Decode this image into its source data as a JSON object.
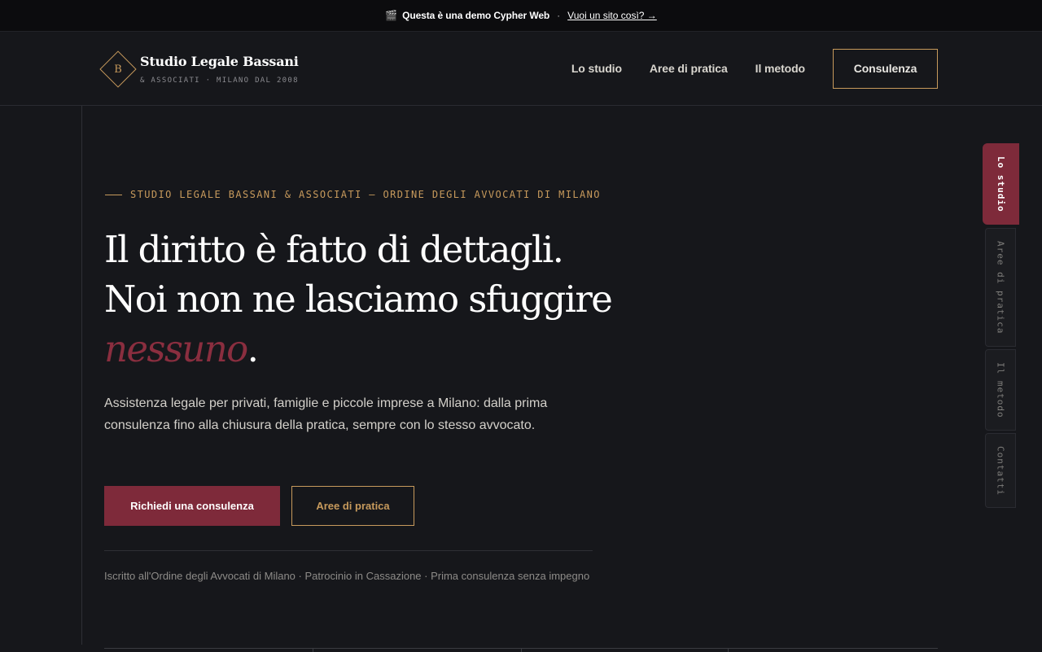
{
  "demo_bar": {
    "icon": "clapperboard-icon",
    "text": "Questa è una demo Cypher Web",
    "separator": "·",
    "link": "Vuoi un sito così? →"
  },
  "brand": {
    "monogram": "B",
    "name": "Studio Legale Bassani",
    "subtitle": "& ASSOCIATI · MILANO DAL 2008"
  },
  "nav": {
    "items": [
      "Lo studio",
      "Aree di pratica",
      "Il metodo"
    ],
    "cta": "Consulenza"
  },
  "hero": {
    "eyebrow": "STUDIO LEGALE BASSANI & ASSOCIATI — ORDINE DEGLI AVVOCATI DI MILANO",
    "headline_line1": "Il diritto è fatto di dettagli.",
    "headline_line2": "Noi non ne lasciamo sfuggire",
    "headline_accent": "nessuno",
    "headline_end": ".",
    "lead": "Assistenza legale per privati, famiglie e piccole imprese a Milano: dalla prima consulenza fino alla chiusura della pratica, sempre con lo stesso avvocato.",
    "primary_button": "Richiedi una consulenza",
    "secondary_button": "Aree di pratica",
    "credentials": "Iscritto all'Ordine degli Avvocati di Milano · Patrocinio in Cassazione · Prima consulenza senza impegno"
  },
  "side_tabs": {
    "items": [
      "Lo studio",
      "Aree di pratica",
      "Il metodo",
      "Contatti"
    ],
    "active": "Lo studio"
  },
  "colors": {
    "background": "#16171b",
    "gold": "#c79a5c",
    "burgundy": "#7e2a3a"
  }
}
